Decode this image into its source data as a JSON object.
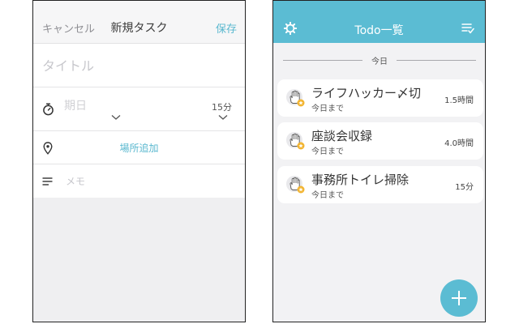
{
  "new_task": {
    "cancel_label": "キャンセル",
    "title": "新規タスク",
    "save_label": "保存",
    "title_placeholder": "タイトル",
    "date_placeholder": "期日",
    "duration_value": "15分",
    "add_place_label": "場所追加",
    "memo_placeholder": "メモ"
  },
  "todo": {
    "title": "Todo一覧",
    "section_label": "今日",
    "items": [
      {
        "title": "ライフハッカー〆切",
        "due": "今日まで",
        "duration": "1.5時間"
      },
      {
        "title": "座談会収録",
        "due": "今日まで",
        "duration": "4.0時間"
      },
      {
        "title": "事務所トイレ掃除",
        "due": "今日まで",
        "duration": "15分"
      }
    ]
  },
  "colors": {
    "accent": "#5bbcd3",
    "placeholder": "#c7c7cc",
    "badge": "#f2b430"
  }
}
